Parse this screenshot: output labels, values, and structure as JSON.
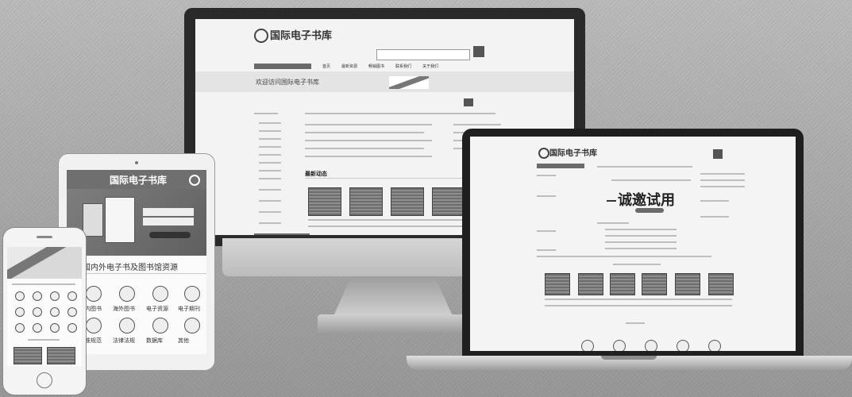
{
  "monitor": {
    "logo": "国际电子书库",
    "notice": "欢迎访问国际电子书库",
    "nav": [
      "首页",
      "最新资源",
      "畅销图书",
      "联系我们",
      "关于我们"
    ],
    "panel_title": "最新动态"
  },
  "laptop": {
    "logo": "国际电子书库",
    "headline": "诚邀试用"
  },
  "tablet": {
    "logo": "国际电子书库",
    "caption": "国内外电子书及图书馆资源",
    "icons": [
      "国内图书",
      "海外图书",
      "电子资源",
      "电子期刊",
      "标准规范",
      "法律法规",
      "数据库",
      "其他"
    ]
  },
  "colors": {
    "frame": "#2a2a2a",
    "screen": "#f3f3f3",
    "silver": "#cfcfcf"
  }
}
